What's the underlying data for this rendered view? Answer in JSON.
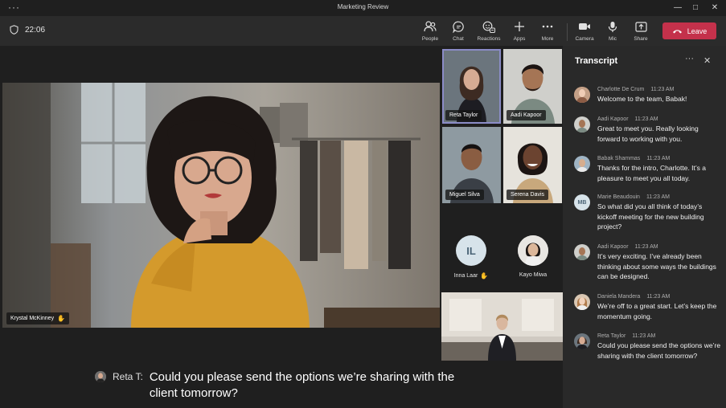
{
  "window": {
    "title": "Marketing Review",
    "menu_glyph": "···"
  },
  "toolbar": {
    "timer": "22:06",
    "items": [
      {
        "label": "People",
        "icon": "people-icon"
      },
      {
        "label": "Chat",
        "icon": "chat-icon"
      },
      {
        "label": "Reactions",
        "icon": "reactions-icon"
      },
      {
        "label": "Apps",
        "icon": "apps-icon"
      },
      {
        "label": "More",
        "icon": "more-icon"
      },
      {
        "label": "Camera",
        "icon": "camera-icon"
      },
      {
        "label": "Mic",
        "icon": "mic-icon"
      },
      {
        "label": "Share",
        "icon": "share-icon"
      }
    ],
    "leave_label": "Leave",
    "leave_color": "#c4314b"
  },
  "stage": {
    "main_speaker": "Krystal McKinney",
    "tiles": [
      {
        "name": "Reta Taylor",
        "active": true
      },
      {
        "name": "Aadi Kapoor"
      },
      {
        "name": "Miguel Silva"
      },
      {
        "name": "Serena Davis"
      }
    ],
    "avatars": [
      {
        "initials": "IL",
        "name": "Inna Laar",
        "hand_raised": true
      },
      {
        "name": "Kayo Miwa"
      }
    ],
    "caption": {
      "speaker": "Reta T:",
      "text": "Could you please send the options we’re sharing with the client tomorrow?"
    }
  },
  "transcript": {
    "title": "Transcript",
    "entries": [
      {
        "name": "Charlotte De Crum",
        "time": "11:23 AM",
        "text": "Welcome to the team, Babak!"
      },
      {
        "name": "Aadi Kapoor",
        "time": "11:23 AM",
        "text": "Great to meet you. Really looking forward to working with you."
      },
      {
        "name": "Babak Shammas",
        "time": "11:23 AM",
        "text": "Thanks for the intro, Charlotte. It’s a pleasure to meet you all today."
      },
      {
        "name": "Marie Beaudouin",
        "initials": "MB",
        "time": "11:23 AM",
        "text": "So what did you all think of today’s kickoff meeting for the new building project?"
      },
      {
        "name": "Aadi Kapoor",
        "time": "11:23 AM",
        "text": "It’s very exciting. I’ve already been thinking about some ways the buildings can be designed."
      },
      {
        "name": "Daniela Mandera",
        "time": "11:23 AM",
        "text": "We’re off to a great start. Let’s keep the momentum going."
      },
      {
        "name": "Reta Taylor",
        "time": "11:23 AM",
        "text": "Could you please send the options we’re sharing with the client tomorrow?"
      }
    ]
  }
}
